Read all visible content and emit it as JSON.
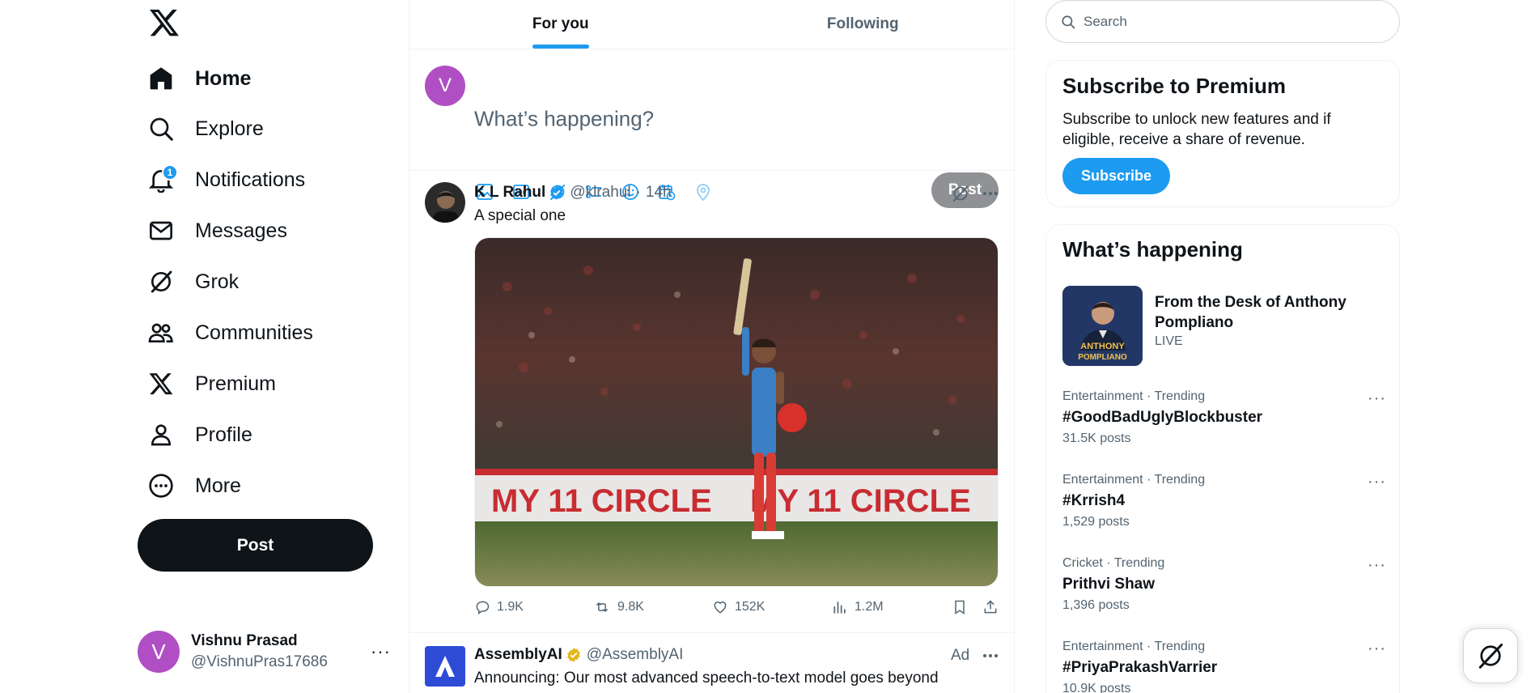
{
  "nav": {
    "items": [
      {
        "label": "Home",
        "icon": "home-icon"
      },
      {
        "label": "Explore",
        "icon": "search-icon"
      },
      {
        "label": "Notifications",
        "icon": "bell-icon",
        "badge": "1"
      },
      {
        "label": "Messages",
        "icon": "mail-icon"
      },
      {
        "label": "Grok",
        "icon": "grok-icon"
      },
      {
        "label": "Communities",
        "icon": "people-icon"
      },
      {
        "label": "Premium",
        "icon": "x-logo-icon"
      },
      {
        "label": "Profile",
        "icon": "person-icon"
      },
      {
        "label": "More",
        "icon": "more-circle-icon"
      }
    ],
    "post_label": "Post"
  },
  "account": {
    "initial": "V",
    "name": "Vishnu Prasad",
    "handle": "@VishnuPras17686",
    "more": "···"
  },
  "tabs": [
    {
      "label": "For you",
      "active": true
    },
    {
      "label": "Following",
      "active": false
    }
  ],
  "composer": {
    "avatar_initial": "V",
    "placeholder": "What’s happening?",
    "post_label": "Post"
  },
  "tweets": [
    {
      "name": "K L Rahul",
      "handle": "@klrahul",
      "time": "14h",
      "text": "A special one",
      "stats": {
        "replies": "1.9K",
        "reposts": "9.8K",
        "likes": "152K",
        "views": "1.2M"
      },
      "media_banner_text": "MY 11 CIRCLE"
    },
    {
      "name": "AssemblyAI",
      "handle": "@AssemblyAI",
      "ad_label": "Ad",
      "text": "Announcing: Our most advanced speech-to-text model goes beyond"
    }
  ],
  "search": {
    "placeholder": "Search"
  },
  "premium": {
    "title": "Subscribe to Premium",
    "body": "Subscribe to unlock new features and if eligible, receive a share of revenue.",
    "button": "Subscribe"
  },
  "happening": {
    "title": "What’s happening",
    "live": {
      "title": "From the Desk of Anthony Pompliano",
      "status": "LIVE",
      "thumb_text_1": "ANTHONY",
      "thumb_text_2": "POMPLIANO"
    },
    "trends": [
      {
        "category": "Entertainment · Trending",
        "topic": "#GoodBadUglyBlockbuster",
        "count": "31.5K posts"
      },
      {
        "category": "Entertainment · Trending",
        "topic": "#Krrish4",
        "count": "1,529 posts"
      },
      {
        "category": "Cricket · Trending",
        "topic": "Prithvi Shaw",
        "count": "1,396 posts"
      },
      {
        "category": "Entertainment · Trending",
        "topic": "#PriyaPrakashVarrier",
        "count": "10.9K posts"
      }
    ],
    "more": "···"
  },
  "colors": {
    "accent": "#1d9bf0",
    "text": "#0f1419",
    "muted": "#536471",
    "avatar": "#b04fc4"
  }
}
